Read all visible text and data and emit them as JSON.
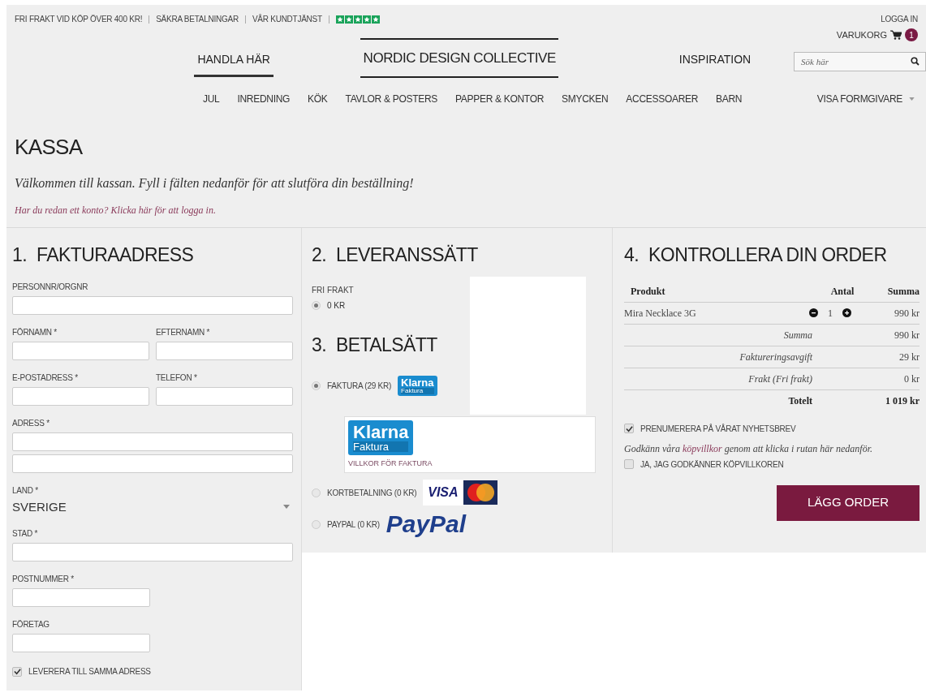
{
  "top_bar": {
    "links": [
      "FRI FRAKT VID KÖP ÖVER 400 KR!",
      "SÄKRA BETALNINGAR",
      "VÅR KUNDTJÄNST"
    ],
    "login": "LOGGA IN"
  },
  "cart": {
    "label": "VARUKORG",
    "count": "1"
  },
  "main_nav": [
    {
      "label": "HANDLA HÄR",
      "selected": true
    },
    {
      "label": "INSPIRATION",
      "selected": false
    }
  ],
  "logo": "NORDIC DESIGN COLLECTIVE",
  "search": {
    "placeholder": "Sök här"
  },
  "categories": [
    "JUL",
    "INREDNING",
    "KÖK",
    "TAVLOR & POSTERS",
    "PAPPER & KONTOR",
    "SMYCKEN",
    "ACCESSOARER",
    "BARN"
  ],
  "designer_menu": "VISA FORMGIVARE",
  "page": {
    "title": "KASSA",
    "intro": "Välkommen till kassan. Fyll i fälten nedanför för att slutföra din beställning!",
    "login_link": "Har du redan ett konto? Klicka här för att logga in."
  },
  "billing": {
    "number": "1.",
    "title": "FAKTURAADRESS",
    "rows": [
      [
        {
          "label": "PERSONNR/ORGNR",
          "kind": "input"
        }
      ],
      [
        {
          "label": "FÖRNAMN *",
          "kind": "input"
        },
        {
          "label": "EFTERNAMN *",
          "kind": "input"
        }
      ],
      [
        {
          "label": "E-POSTADRESS *",
          "kind": "input"
        },
        {
          "label": "TELEFON *",
          "kind": "input"
        }
      ],
      [
        {
          "label": "ADRESS *",
          "kind": "double_input"
        }
      ],
      [
        {
          "label": "LAND *",
          "kind": "select",
          "value": "SVERIGE"
        }
      ],
      [
        {
          "label": "STAD *",
          "kind": "input"
        }
      ],
      [
        {
          "label": "POSTNUMMER *",
          "kind": "short_input"
        }
      ],
      [
        {
          "label": "FÖRETAG",
          "kind": "short_input"
        }
      ]
    ],
    "same_address": {
      "label": "LEVERERA TILL SAMMA ADRESS",
      "checked": true
    }
  },
  "delivery": {
    "number": "2.",
    "title": "LEVERANSSÄTT",
    "group_label": "FRI FRAKT",
    "options": [
      {
        "label": "0 KR",
        "selected": true
      }
    ]
  },
  "payment": {
    "number": "3.",
    "title": "BETALSÄTT",
    "options": [
      {
        "label": "FAKTURA (29 KR)",
        "selected": true,
        "kind": "klarna",
        "logo": [
          "Klarna",
          "Faktura"
        ]
      },
      {
        "label": "KORTBETALNING (0 KR)",
        "selected": false,
        "kind": "card",
        "logo": [
          "VISA"
        ]
      },
      {
        "label": "PAYPAL (0 KR)",
        "selected": false,
        "kind": "paypal",
        "logo": [
          "PayPal"
        ]
      }
    ],
    "klarna_popup": {
      "logo": [
        "Klarna",
        "Faktura"
      ],
      "link": "VILLKOR FÖR FAKTURA"
    }
  },
  "order": {
    "number": "4.",
    "title": "KONTROLLERA DIN ORDER",
    "columns": [
      "Produkt",
      "Antal",
      "Summa"
    ],
    "items": [
      {
        "name": "Mira Necklace 3G",
        "quantity": "1",
        "price": "990 kr"
      }
    ],
    "summary": [
      {
        "label": "Summa",
        "value": "990 kr",
        "total": false
      },
      {
        "label": "Faktureringsavgift",
        "value": "29 kr",
        "total": false
      },
      {
        "label": "Frakt (Fri frakt)",
        "value": "0 kr",
        "total": false
      },
      {
        "label": "Totelt",
        "value": "1 019 kr",
        "total": true
      }
    ],
    "newsletter": {
      "label": "PRENUMERERA PÅ VÅRAT NYHETSBREV",
      "checked": true
    },
    "terms": {
      "before": "Godkänn våra",
      "link": "köpvillkor",
      "after": "genom att klicka i rutan här nedanför."
    },
    "accept": {
      "label": "JA, JAG GODKÄNNER KÖPVILLKOREN",
      "checked": false
    },
    "button": "LÄGG ORDER"
  }
}
